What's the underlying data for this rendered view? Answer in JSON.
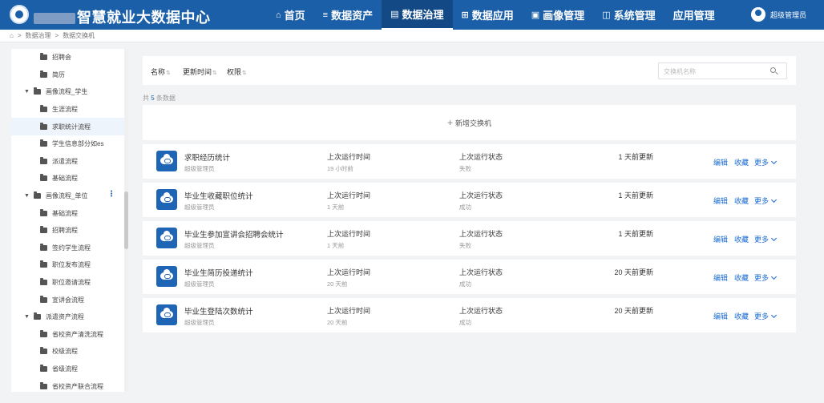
{
  "header": {
    "title": "智慧就业大数据中心",
    "nav": [
      {
        "label": "首页",
        "icon": "home-icon",
        "glyph": "⌂",
        "active": false
      },
      {
        "label": "数据资产",
        "icon": "database-icon",
        "glyph": "≡",
        "active": false
      },
      {
        "label": "数据治理",
        "icon": "governance-icon",
        "glyph": "▤",
        "active": true
      },
      {
        "label": "数据应用",
        "icon": "apps-icon",
        "glyph": "⊞",
        "active": false
      },
      {
        "label": "画像管理",
        "icon": "portrait-icon",
        "glyph": "▣",
        "active": false
      },
      {
        "label": "系统管理",
        "icon": "system-icon",
        "glyph": "◫",
        "active": false
      },
      {
        "label": "应用管理",
        "icon": "",
        "glyph": "",
        "active": false
      }
    ],
    "user": "超级管理员",
    "colors": {
      "primary": "#1a5fa8",
      "link": "#1a6bd1"
    }
  },
  "breadcrumb": [
    "数据治理",
    "数据交换机"
  ],
  "sidebar": {
    "items": [
      {
        "label": "招聘会",
        "level": 2
      },
      {
        "label": "简历",
        "level": 2
      },
      {
        "label": "画像流程_学生",
        "level": 1
      },
      {
        "label": "生涯流程",
        "level": 2
      },
      {
        "label": "求职统计流程",
        "level": 2,
        "active": true
      },
      {
        "label": "学生信息部分如es",
        "level": 2
      },
      {
        "label": "派遣流程",
        "level": 2
      },
      {
        "label": "基础流程",
        "level": 2
      },
      {
        "label": "画像流程_单位",
        "level": 1,
        "more": true
      },
      {
        "label": "基础流程",
        "level": 2
      },
      {
        "label": "招聘流程",
        "level": 2
      },
      {
        "label": "签约学生流程",
        "level": 2
      },
      {
        "label": "职位发布流程",
        "level": 2
      },
      {
        "label": "职位邀请流程",
        "level": 2
      },
      {
        "label": "宣讲会流程",
        "level": 2
      },
      {
        "label": "派遣资产流程",
        "level": 1
      },
      {
        "label": "省校资产清洗流程",
        "level": 2
      },
      {
        "label": "校级流程",
        "level": 2
      },
      {
        "label": "省级流程",
        "level": 2
      },
      {
        "label": "省校资产联合流程",
        "level": 2
      }
    ]
  },
  "toolbar": {
    "sort": [
      "名称",
      "更新时间",
      "权限"
    ],
    "search_placeholder": "交换机名称"
  },
  "count": {
    "prefix": "共",
    "value": "5",
    "suffix": "条数据"
  },
  "new_button": "新增交换机",
  "labels": {
    "last_run_time": "上次运行时间",
    "last_run_status": "上次运行状态",
    "edit": "编辑",
    "favorite": "收藏",
    "more": "更多"
  },
  "exchanges": [
    {
      "name": "求职经历统计",
      "owner": "超级管理员",
      "run_time": "19 小时前",
      "status": "失败",
      "updated": "1 天前更新"
    },
    {
      "name": "毕业生收藏职位统计",
      "owner": "超级管理员",
      "run_time": "1 天前",
      "status": "成功",
      "updated": "1 天前更新"
    },
    {
      "name": "毕业生参加宣讲会招聘会统计",
      "owner": "超级管理员",
      "run_time": "1 天前",
      "status": "失败",
      "updated": "1 天前更新"
    },
    {
      "name": "毕业生简历投递统计",
      "owner": "超级管理员",
      "run_time": "20 天前",
      "status": "成功",
      "updated": "20 天前更新"
    },
    {
      "name": "毕业生登陆次数统计",
      "owner": "超级管理员",
      "run_time": "20 天前",
      "status": "成功",
      "updated": "20 天前更新"
    }
  ]
}
